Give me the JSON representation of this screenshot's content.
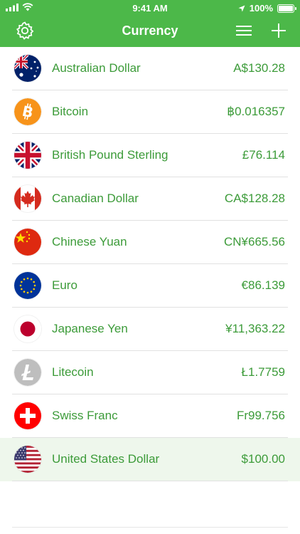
{
  "status_bar": {
    "time": "9:41 AM",
    "battery": "100%"
  },
  "nav": {
    "title": "Currency",
    "settings_icon": "gear-icon",
    "menu_icon": "hamburger-icon",
    "add_icon": "plus-icon"
  },
  "colors": {
    "accent": "#4cb849",
    "text_green": "#3c9b39",
    "selected_row": "#eef7ec"
  },
  "currencies": [
    {
      "name": "Australian Dollar",
      "amount": "A$130.28",
      "flag": "australia-flag"
    },
    {
      "name": "Bitcoin",
      "amount": "฿0.016357",
      "flag": "bitcoin-logo"
    },
    {
      "name": "British Pound Sterling",
      "amount": "£76.114",
      "flag": "uk-flag"
    },
    {
      "name": "Canadian Dollar",
      "amount": "CA$128.28",
      "flag": "canada-flag"
    },
    {
      "name": "Chinese Yuan",
      "amount": "CN¥665.56",
      "flag": "china-flag"
    },
    {
      "name": "Euro",
      "amount": "€86.139",
      "flag": "eu-flag"
    },
    {
      "name": "Japanese Yen",
      "amount": "¥11,363.22",
      "flag": "japan-flag"
    },
    {
      "name": "Litecoin",
      "amount": "Ł1.7759",
      "flag": "litecoin-logo"
    },
    {
      "name": "Swiss Franc",
      "amount": "Fr99.756",
      "flag": "switzerland-flag"
    },
    {
      "name": "United States Dollar",
      "amount": "$100.00",
      "flag": "usa-flag",
      "selected": true
    }
  ]
}
